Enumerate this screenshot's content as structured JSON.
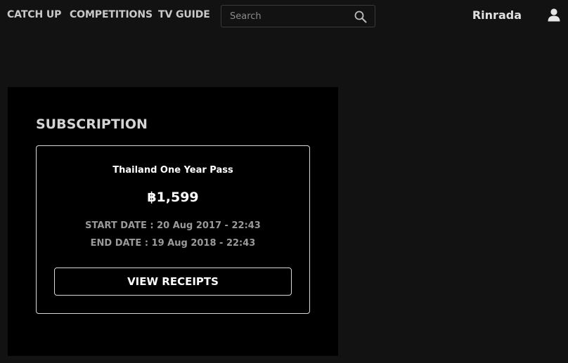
{
  "nav": {
    "items": [
      {
        "label": "CATCH UP"
      },
      {
        "label": "COMPETITIONS"
      },
      {
        "label": "TV GUIDE"
      }
    ]
  },
  "search": {
    "placeholder": "Search",
    "value": "",
    "icon": "search-icon"
  },
  "user": {
    "name": "Rinrada",
    "icon": "user-icon"
  },
  "subscription": {
    "title": "SUBSCRIPTION",
    "plan_name": "Thailand One Year Pass",
    "price": "฿1,599",
    "start_date": "START DATE : 20 Aug 2017 - 22:43",
    "end_date": "END DATE : 19 Aug 2018 - 22:43",
    "view_receipts_label": "VIEW RECEIPTS"
  },
  "colors": {
    "page_background": "#121212",
    "panel_background": "#000000",
    "nav_text": "#c9c9c9",
    "muted_text": "#9a9a9a",
    "primary_text": "#ffffff"
  }
}
